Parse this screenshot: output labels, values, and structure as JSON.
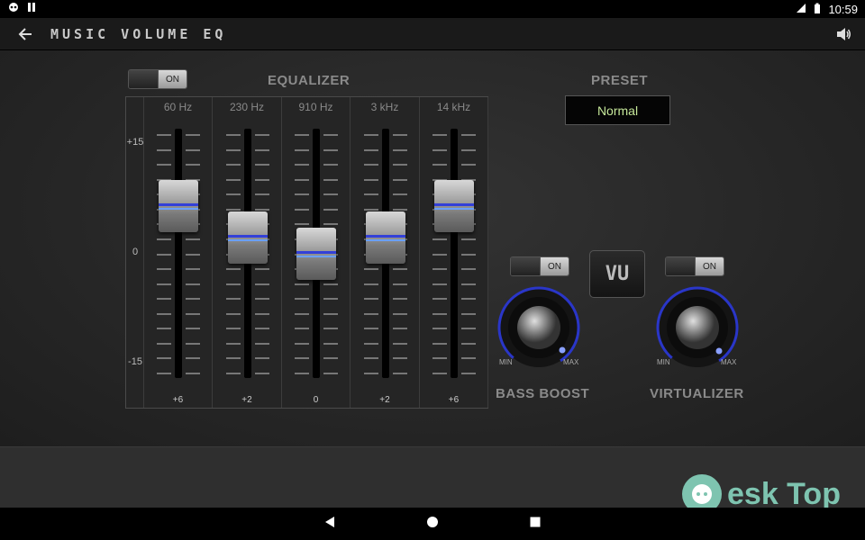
{
  "status_bar": {
    "time": "10:59",
    "left_icons": [
      "app-notification-icon",
      "sim-icon"
    ],
    "right_icons": [
      "signal-icon",
      "battery-icon"
    ]
  },
  "app_bar": {
    "title": "MUSIC VOLUME EQ",
    "back_icon": "arrow-left-icon",
    "volume_icon": "speaker-icon"
  },
  "equalizer": {
    "heading": "EQUALIZER",
    "toggle_label": "ON",
    "scale": {
      "top": "+15",
      "mid": "0",
      "bottom": "-15"
    },
    "range": [
      -15,
      15
    ],
    "bands": [
      {
        "freq": "60 Hz",
        "value_label": "+6",
        "value": 6
      },
      {
        "freq": "230 Hz",
        "value_label": "+2",
        "value": 2
      },
      {
        "freq": "910 Hz",
        "value_label": "0",
        "value": 0
      },
      {
        "freq": "3 kHz",
        "value_label": "+2",
        "value": 2
      },
      {
        "freq": "14 kHz",
        "value_label": "+6",
        "value": 6
      }
    ]
  },
  "preset": {
    "heading": "PRESET",
    "value": "Normal"
  },
  "vu_button": {
    "label": "VU"
  },
  "bass_boost": {
    "label": "BASS BOOST",
    "toggle_label": "ON",
    "min_label": "MIN",
    "max_label": "MAX",
    "level": 1.0
  },
  "virtualizer": {
    "label": "VIRTUALIZER",
    "toggle_label": "ON",
    "min_label": "MIN",
    "max_label": "MAX",
    "level": 1.0
  },
  "colors": {
    "accent_blue": "#3340d8",
    "preset_text": "#c6e89a"
  },
  "watermark": {
    "text": "esk Top"
  }
}
